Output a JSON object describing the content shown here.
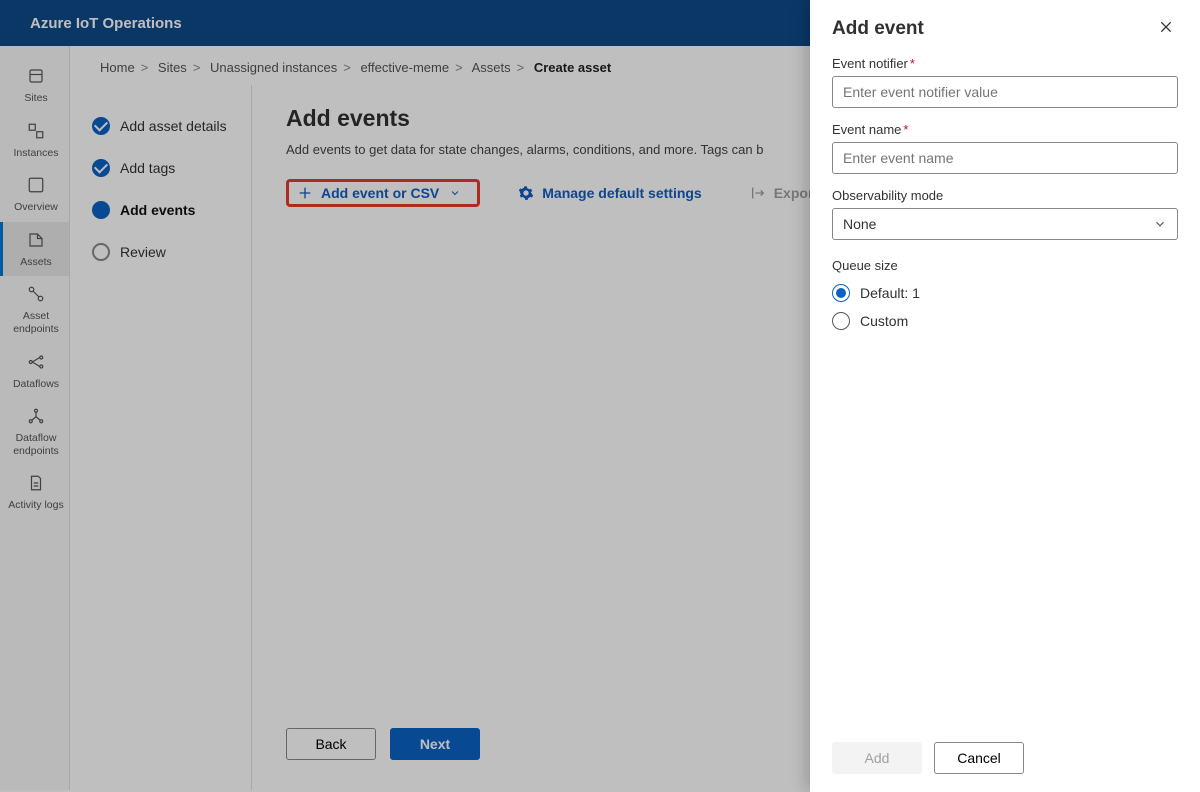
{
  "app_title": "Azure IoT Operations",
  "leftnav": {
    "items": [
      {
        "label": "Sites",
        "icon": "map"
      },
      {
        "label": "Instances",
        "icon": "instances"
      },
      {
        "label": "Overview",
        "icon": "overview"
      },
      {
        "label": "Assets",
        "icon": "assets",
        "active": true
      },
      {
        "label": "Asset endpoints",
        "icon": "asset-endpoints"
      },
      {
        "label": "Dataflows",
        "icon": "dataflows"
      },
      {
        "label": "Dataflow endpoints",
        "icon": "dataflow-endpoints"
      },
      {
        "label": "Activity logs",
        "icon": "logs"
      }
    ]
  },
  "breadcrumb": {
    "items": [
      "Home",
      "Sites",
      "Unassigned instances",
      "effective-meme",
      "Assets"
    ],
    "current": "Create asset"
  },
  "steps": {
    "items": [
      {
        "label": "Add asset details",
        "state": "done"
      },
      {
        "label": "Add tags",
        "state": "done"
      },
      {
        "label": "Add events",
        "state": "current"
      },
      {
        "label": "Review",
        "state": "pending"
      }
    ]
  },
  "main": {
    "heading": "Add events",
    "description": "Add events to get data for state changes, alarms, conditions, and more. Tags can b",
    "actions": {
      "add_label": "Add event or CSV",
      "manage_label": "Manage default settings",
      "export_label": "Export a"
    },
    "back_label": "Back",
    "next_label": "Next"
  },
  "panel": {
    "title": "Add event",
    "fields": {
      "notifier": {
        "label": "Event notifier",
        "placeholder": "Enter event notifier value",
        "required": true
      },
      "name": {
        "label": "Event name",
        "placeholder": "Enter event name",
        "required": true
      },
      "observability": {
        "label": "Observability mode",
        "value": "None"
      },
      "queue": {
        "label": "Queue size",
        "options": [
          "Default: 1",
          "Custom"
        ],
        "selected": 0
      }
    },
    "add_label": "Add",
    "cancel_label": "Cancel"
  }
}
